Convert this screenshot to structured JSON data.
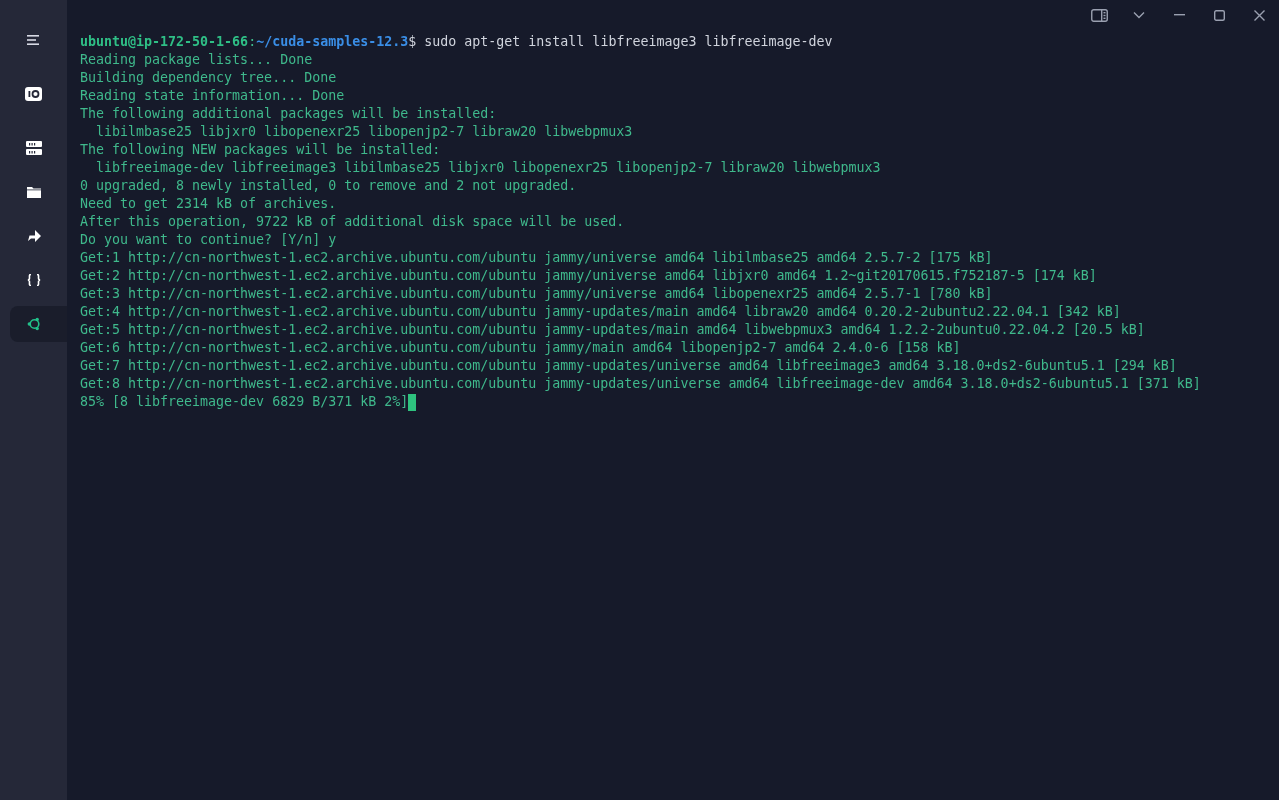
{
  "sidebar": {
    "items": [
      {
        "kind": "menu",
        "selected": false
      },
      {
        "kind": "session",
        "selected": false
      },
      {
        "kind": "server",
        "selected": false
      },
      {
        "kind": "folder",
        "selected": false
      },
      {
        "kind": "forward",
        "selected": false
      },
      {
        "kind": "braces",
        "selected": false
      },
      {
        "kind": "ubuntu",
        "selected": true
      }
    ]
  },
  "terminal": {
    "lines": [
      {
        "kind": "prompt",
        "user": "ubuntu@ip-172-50-1-66",
        "separator": ":",
        "path": "~/cuda-samples-12.3",
        "command": "$ sudo apt-get install libfreeimage3 libfreeimage-dev"
      },
      {
        "kind": "output",
        "text": "Reading package lists... Done"
      },
      {
        "kind": "output",
        "text": "Building dependency tree... Done"
      },
      {
        "kind": "output",
        "text": "Reading state information... Done"
      },
      {
        "kind": "output",
        "text": "The following additional packages will be installed:"
      },
      {
        "kind": "output",
        "text": "  libilmbase25 libjxr0 libopenexr25 libopenjp2-7 libraw20 libwebpmux3"
      },
      {
        "kind": "output",
        "text": "The following NEW packages will be installed:"
      },
      {
        "kind": "output",
        "text": "  libfreeimage-dev libfreeimage3 libilmbase25 libjxr0 libopenexr25 libopenjp2-7 libraw20 libwebpmux3"
      },
      {
        "kind": "output",
        "text": "0 upgraded, 8 newly installed, 0 to remove and 2 not upgraded."
      },
      {
        "kind": "output",
        "text": "Need to get 2314 kB of archives."
      },
      {
        "kind": "output",
        "text": "After this operation, 9722 kB of additional disk space will be used."
      },
      {
        "kind": "output",
        "text": "Do you want to continue? [Y/n] y"
      },
      {
        "kind": "output",
        "text": "Get:1 http://cn-northwest-1.ec2.archive.ubuntu.com/ubuntu jammy/universe amd64 libilmbase25 amd64 2.5.7-2 [175 kB]"
      },
      {
        "kind": "output",
        "text": "Get:2 http://cn-northwest-1.ec2.archive.ubuntu.com/ubuntu jammy/universe amd64 libjxr0 amd64 1.2~git20170615.f752187-5 [174 kB]"
      },
      {
        "kind": "output",
        "text": "Get:3 http://cn-northwest-1.ec2.archive.ubuntu.com/ubuntu jammy/universe amd64 libopenexr25 amd64 2.5.7-1 [780 kB]"
      },
      {
        "kind": "output",
        "text": "Get:4 http://cn-northwest-1.ec2.archive.ubuntu.com/ubuntu jammy-updates/main amd64 libraw20 amd64 0.20.2-2ubuntu2.22.04.1 [342 kB]"
      },
      {
        "kind": "output",
        "text": "Get:5 http://cn-northwest-1.ec2.archive.ubuntu.com/ubuntu jammy-updates/main amd64 libwebpmux3 amd64 1.2.2-2ubuntu0.22.04.2 [20.5 kB]"
      },
      {
        "kind": "output",
        "text": "Get:6 http://cn-northwest-1.ec2.archive.ubuntu.com/ubuntu jammy/main amd64 libopenjp2-7 amd64 2.4.0-6 [158 kB]"
      },
      {
        "kind": "output",
        "text": "Get:7 http://cn-northwest-1.ec2.archive.ubuntu.com/ubuntu jammy-updates/universe amd64 libfreeimage3 amd64 3.18.0+ds2-6ubuntu5.1 [294 kB]"
      },
      {
        "kind": "output",
        "text": "Get:8 http://cn-northwest-1.ec2.archive.ubuntu.com/ubuntu jammy-updates/universe amd64 libfreeimage-dev amd64 3.18.0+ds2-6ubuntu5.1 [371 kB]"
      },
      {
        "kind": "progress",
        "text": "85% [8 libfreeimage-dev 6829 B/371 kB 2%]"
      }
    ]
  }
}
